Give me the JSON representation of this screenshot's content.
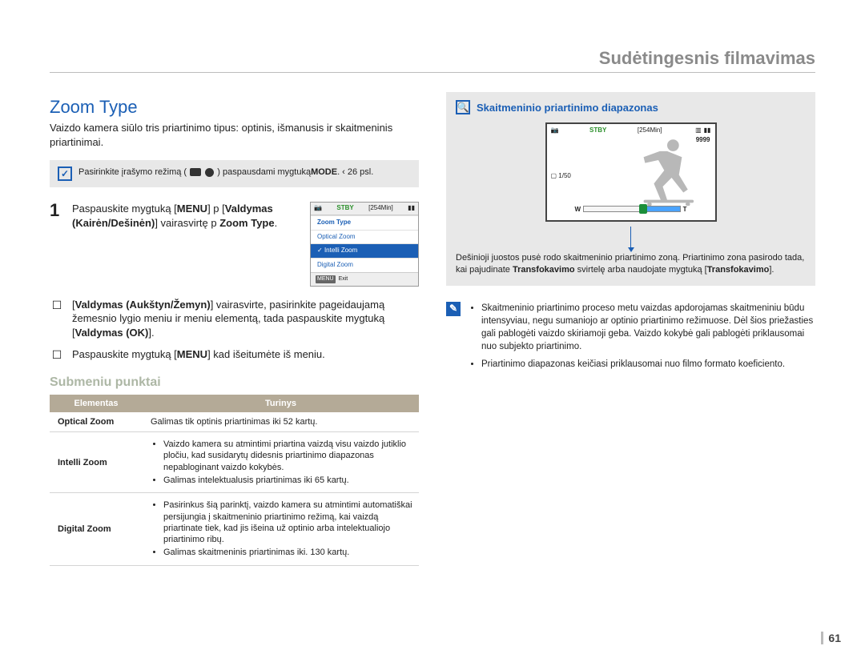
{
  "header": {
    "section": "Sudėtingesnis filmavimas"
  },
  "title": "Zoom Type",
  "intro": "Vaizdo kamera siūlo tris priartinimo tipus: optinis, išmanusis ir skaitmeninis priartinimai.",
  "mode_note": {
    "prefix": "Pasirinkite įrašymo režimą (",
    "suffix": ") paspausdami mygtuką ",
    "bold1": "MODE",
    "tail": ". ‹ 26 psl."
  },
  "steps": {
    "s1_a": "Paspauskite mygtuką [",
    "s1_menu": "MENU",
    "s1_b": "] p [",
    "s1_c": "Valdymas (Kairėn/Dešinėn)",
    "s1_d": "] vairasvirtę p ",
    "s1_e": "Zoom Type",
    "s1_f": ".",
    "s2_a": "[",
    "s2_b": "Valdymas (Aukštyn/Žemyn)",
    "s2_c": "] vairasvirte, pasirinkite pageidaujamą žemesnio lygio meniu ir meniu elementą, tada paspauskite mygtuką [",
    "s2_d": "Valdymas (OK)",
    "s2_e": "].",
    "s3_a": "Paspauskite mygtuką [",
    "s3_menu": "MENU",
    "s3_b": "] kad išeitumėte iš meniu."
  },
  "menu_overlay": {
    "stby": "STBY",
    "time": "[254Min]",
    "items": [
      "Zoom Type",
      "Optical Zoom",
      "Intelli Zoom",
      "Digital Zoom"
    ],
    "exit_btn": "MENU",
    "exit_lbl": "Exit"
  },
  "submenu_heading": "Submeniu punktai",
  "table": {
    "h1": "Elementas",
    "h2": "Turinys",
    "rows": [
      {
        "name": "Optical Zoom",
        "plain": "Galimas tik optinis priartinimas iki 52 kartų."
      },
      {
        "name": "Intelli Zoom",
        "bullets": [
          "Vaizdo kamera su atmintimi priartina vaizdą visu vaizdo jutiklio pločiu, kad susidarytų didesnis priartinimo diapazonas nepabloginant vaizdo kokybės.",
          "Galimas intelektualusis priartinimas iki 65 kartų."
        ]
      },
      {
        "name": "Digital Zoom",
        "bullets": [
          "Pasirinkus šią parinktį, vaizdo kamera su atmintimi automatiškai persijungia į skaitmeninio priartinimo režimą, kai vaizdą priartinate tiek, kad jis išeina už optinio arba intelektualiojo priartinimo ribų.",
          "Galimas skaitmeninis priartinimas iki. 130 kartų."
        ]
      }
    ]
  },
  "right": {
    "heading": "Skaitmeninio priartinimo diapazonas",
    "display": {
      "stby": "STBY",
      "time": "[254Min]",
      "n9999": "9999",
      "frac": "1/50",
      "w": "W",
      "t": "T"
    },
    "desc_a": "Dešinioji juostos pusė rodo skaitmeninio priartinimo zoną. Priartinimo zona pasirodo tada, kai pajudinate ",
    "desc_b": "Transfokavimo",
    "desc_c": " svirtelę arba naudojate mygtuką [",
    "desc_d": "Transfokavimo",
    "desc_e": "].",
    "bullets": [
      "Skaitmeninio priartinimo proceso metu vaizdas apdorojamas skaitmeniniu būdu intensyviau, negu sumaniojo ar optinio priartinimo režimuose. Dėl šios priežasties gali pablogėti vaizdo skiriamoji geba. Vaizdo kokybė gali pablogėti priklausomai nuo subjekto priartinimo.",
      "Priartinimo diapazonas keičiasi priklausomai nuo filmo formato koeficiento."
    ]
  },
  "page_number": "61"
}
